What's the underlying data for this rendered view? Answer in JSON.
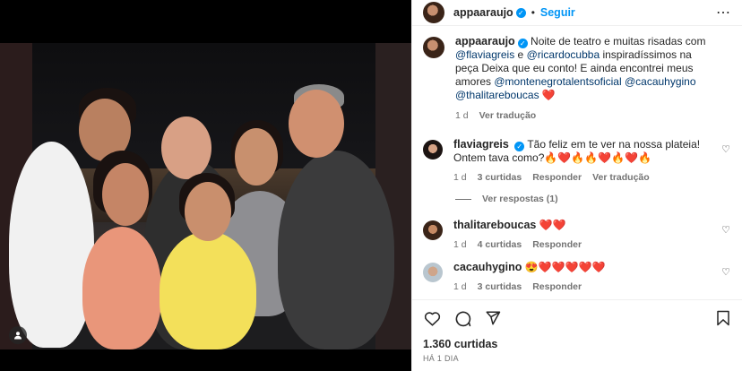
{
  "header": {
    "username": "appaaraujo",
    "separator": "•",
    "follow_label": "Seguir",
    "more_label": "⋯"
  },
  "caption": {
    "username": "appaaraujo",
    "text_1": "Noite de teatro e muitas risadas com",
    "mention_1": "@flaviagreis",
    "text_2": " e ",
    "mention_2": "@ricardocubba",
    "text_3": " inspiradíssimos na peça Deixa que eu conto! E ainda encontrei meus amores ",
    "mention_3": "@montenegrotalentsoficial",
    "mention_4": "@cacauhygino",
    "mention_5": "@thalitareboucas",
    "emoji": "❤️",
    "age": "1 d",
    "translate_label": "Ver tradução"
  },
  "comments": [
    {
      "username": "flaviagreis",
      "text": "Tão feliz em te ver na nossa plateia! Ontem tava como?🔥❤️🔥🔥❤️🔥❤️🔥",
      "age": "1 d",
      "likes": "3 curtidas",
      "reply_label": "Responder",
      "translate_label": "Ver tradução",
      "replies_label": "Ver respostas (1)"
    },
    {
      "username": "thalitareboucas",
      "text": "❤️❤️",
      "age": "1 d",
      "likes": "4 curtidas",
      "reply_label": "Responder"
    },
    {
      "username": "cacauhygino",
      "text": "😍❤️❤️❤️❤️❤️",
      "age": "1 d",
      "likes": "3 curtidas",
      "reply_label": "Responder"
    }
  ],
  "footer": {
    "likes": "1.360 curtidas",
    "time": "HÁ 1 DIA"
  },
  "colors": {
    "accent": "#0095f6",
    "mention": "#00376b",
    "muted": "#737373"
  },
  "icons": {
    "like": "heart-icon",
    "comment": "comment-icon",
    "share": "share-icon",
    "save": "bookmark-icon",
    "tagged": "user-tag-icon"
  }
}
